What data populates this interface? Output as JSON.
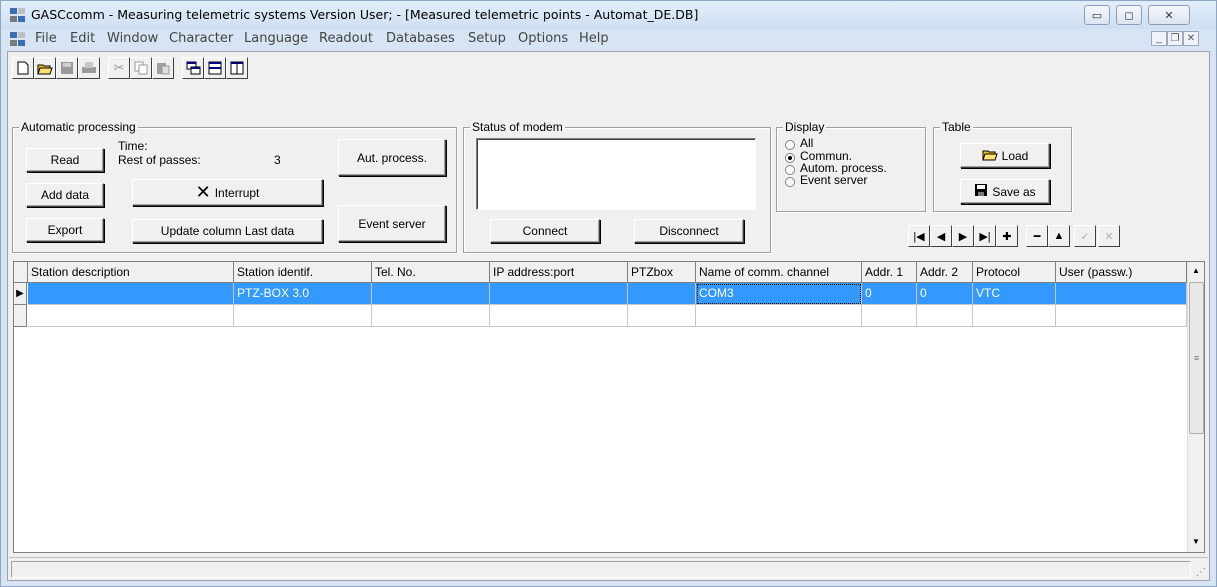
{
  "window": {
    "title": "GASCcomm - Measuring telemetric systems  Version User;   - [Measured telemetric points - Automat_DE.DB]",
    "controls": {
      "minimize": "▭",
      "maximize": "◻",
      "close": "✕"
    },
    "mdi_controls": {
      "minimize": "_",
      "restore": "❐",
      "close": "✕"
    }
  },
  "menu": {
    "items": [
      "File",
      "Edit",
      "Window",
      "Character",
      "Language",
      "Readout",
      "Databases",
      "Setup",
      "Options",
      "Help"
    ]
  },
  "toolbar": {
    "icons": [
      "new-file-icon",
      "open-folder-icon",
      "save-icon",
      "print-icon",
      "cut-icon",
      "copy-icon",
      "paste-icon",
      "cascade-icon",
      "tile-horizontal-icon",
      "tile-vertical-icon"
    ]
  },
  "auto": {
    "group_label": "Automatic processing",
    "read": "Read",
    "add_data": "Add data",
    "export": "Export",
    "time_label": "Time:",
    "passes_label": "Rest of passes:",
    "passes_value": "3",
    "interrupt": "Interrupt",
    "update_column": "Update column Last data",
    "aut_process": "Aut. process.",
    "event_server": "Event server"
  },
  "modem": {
    "group_label": "Status of modem",
    "connect": "Connect",
    "disconnect": "Disconnect"
  },
  "display": {
    "group_label": "Display",
    "options": [
      "All",
      "Commun.",
      "Autom. process.",
      "Event server"
    ],
    "selected": "Commun."
  },
  "table_group": {
    "group_label": "Table",
    "load": "Load",
    "save_as": "Save as"
  },
  "navigator": {
    "buttons": [
      "first",
      "prior",
      "next",
      "last",
      "insert",
      "delete",
      "edit",
      "post",
      "cancel"
    ],
    "glyphs": [
      "|◀",
      "◀",
      "▶",
      "▶|",
      "✚",
      "━",
      "▲",
      "✓",
      "✕"
    ]
  },
  "grid": {
    "columns": [
      "Station description",
      "Station identif.",
      "Tel. No.",
      "IP address:port",
      "PTZbox",
      "Name of comm. channel",
      "Addr. 1",
      "Addr. 2",
      "Protocol",
      "User (passw.)"
    ],
    "rows": [
      [
        "",
        "PTZ-BOX 3.0",
        "",
        "",
        "",
        "COM3",
        "0",
        "0",
        "VTC",
        ""
      ],
      [
        "",
        "",
        "",
        "",
        "",
        "",
        "",
        "",
        "",
        ""
      ]
    ],
    "selected_row": 0,
    "focused_column": 5,
    "row_indicator": "▶",
    "scroll_grip": "≡"
  },
  "colors": {
    "selection": "#3399ff",
    "face": "#f0f0f0",
    "frame": "#d6e4f3"
  }
}
